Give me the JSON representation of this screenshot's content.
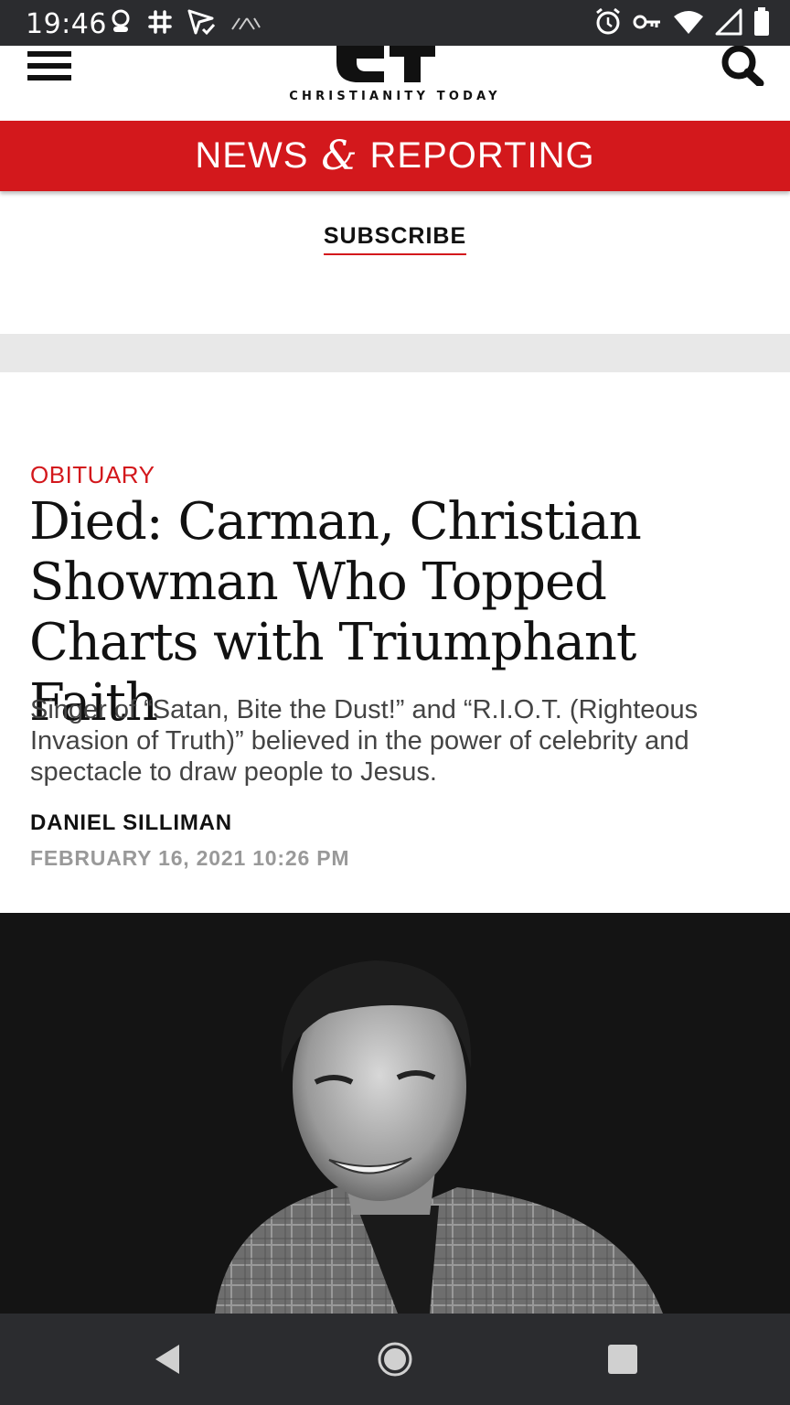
{
  "status_bar": {
    "time": "19:46",
    "left_icons": [
      "account-icon",
      "slack-icon",
      "send-check-icon",
      "signal-arrows-icon"
    ],
    "right_icons": [
      "alarm-icon",
      "vpn-key-icon",
      "wifi-icon",
      "cell-signal-icon",
      "battery-icon"
    ]
  },
  "header": {
    "logo_text": "CHRISTIANITY TODAY",
    "menu_icon": "hamburger-menu-icon",
    "search_icon": "search-icon"
  },
  "section": {
    "word1": "NEWS",
    "amp": "&",
    "word2": "REPORTING",
    "color": "#d3181c"
  },
  "subscribe": {
    "label": "SUBSCRIBE"
  },
  "article": {
    "category": "OBITUARY",
    "headline": "Died: Carman, Christian Showman Who Topped Charts with Triumphant Faith",
    "dek": "Singer of “Satan, Bite the Dust!” and “R.I.O.T. (Righteous Invasion of Truth)” believed in the power of celebrity and spectacle to draw people to Jesus.",
    "author": "DANIEL SILLIMAN",
    "date": "FEBRUARY 16, 2021 10:26 PM"
  },
  "photo": {
    "subject": "portrait-photo"
  },
  "nav_bar": {
    "back_icon": "back-triangle-icon",
    "home_icon": "home-circle-icon",
    "recents_icon": "recents-square-icon"
  }
}
